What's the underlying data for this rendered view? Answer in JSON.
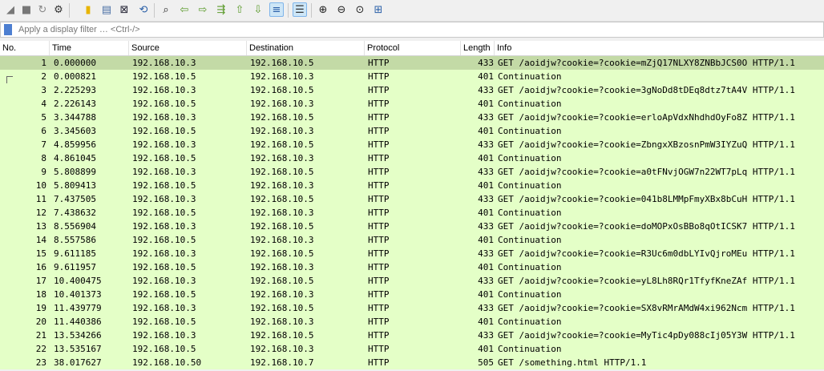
{
  "filter": {
    "placeholder": "Apply a display filter … <Ctrl-/>"
  },
  "columns": [
    "No.",
    "Time",
    "Source",
    "Destination",
    "Protocol",
    "Length",
    "Info"
  ],
  "packets": [
    {
      "no": "1",
      "time": "0.000000",
      "src": "192.168.10.3",
      "dst": "192.168.10.5",
      "proto": "HTTP",
      "len": "433",
      "info": "GET /aoidjw?cookie=?cookie=mZjQ17NLXY8ZNBbJCS0O HTTP/1.1"
    },
    {
      "no": "2",
      "time": "0.000821",
      "src": "192.168.10.5",
      "dst": "192.168.10.3",
      "proto": "HTTP",
      "len": "401",
      "info": "Continuation"
    },
    {
      "no": "3",
      "time": "2.225293",
      "src": "192.168.10.3",
      "dst": "192.168.10.5",
      "proto": "HTTP",
      "len": "433",
      "info": "GET /aoidjw?cookie=?cookie=3gNoDd8tDEq8dtz7tA4V HTTP/1.1"
    },
    {
      "no": "4",
      "time": "2.226143",
      "src": "192.168.10.5",
      "dst": "192.168.10.3",
      "proto": "HTTP",
      "len": "401",
      "info": "Continuation"
    },
    {
      "no": "5",
      "time": "3.344788",
      "src": "192.168.10.3",
      "dst": "192.168.10.5",
      "proto": "HTTP",
      "len": "433",
      "info": "GET /aoidjw?cookie=?cookie=erloApVdxNhdhdOyFo8Z HTTP/1.1"
    },
    {
      "no": "6",
      "time": "3.345603",
      "src": "192.168.10.5",
      "dst": "192.168.10.3",
      "proto": "HTTP",
      "len": "401",
      "info": "Continuation"
    },
    {
      "no": "7",
      "time": "4.859956",
      "src": "192.168.10.3",
      "dst": "192.168.10.5",
      "proto": "HTTP",
      "len": "433",
      "info": "GET /aoidjw?cookie=?cookie=ZbngxXBzosnPmW3IYZuQ HTTP/1.1"
    },
    {
      "no": "8",
      "time": "4.861045",
      "src": "192.168.10.5",
      "dst": "192.168.10.3",
      "proto": "HTTP",
      "len": "401",
      "info": "Continuation"
    },
    {
      "no": "9",
      "time": "5.808899",
      "src": "192.168.10.3",
      "dst": "192.168.10.5",
      "proto": "HTTP",
      "len": "433",
      "info": "GET /aoidjw?cookie=?cookie=a0tFNvjOGW7n22WT7pLq HTTP/1.1"
    },
    {
      "no": "10",
      "time": "5.809413",
      "src": "192.168.10.5",
      "dst": "192.168.10.3",
      "proto": "HTTP",
      "len": "401",
      "info": "Continuation"
    },
    {
      "no": "11",
      "time": "7.437505",
      "src": "192.168.10.3",
      "dst": "192.168.10.5",
      "proto": "HTTP",
      "len": "433",
      "info": "GET /aoidjw?cookie=?cookie=041b8LMMpFmyXBx8bCuH HTTP/1.1"
    },
    {
      "no": "12",
      "time": "7.438632",
      "src": "192.168.10.5",
      "dst": "192.168.10.3",
      "proto": "HTTP",
      "len": "401",
      "info": "Continuation"
    },
    {
      "no": "13",
      "time": "8.556904",
      "src": "192.168.10.3",
      "dst": "192.168.10.5",
      "proto": "HTTP",
      "len": "433",
      "info": "GET /aoidjw?cookie=?cookie=doMOPxOsBBo8qOtICSK7 HTTP/1.1"
    },
    {
      "no": "14",
      "time": "8.557586",
      "src": "192.168.10.5",
      "dst": "192.168.10.3",
      "proto": "HTTP",
      "len": "401",
      "info": "Continuation"
    },
    {
      "no": "15",
      "time": "9.611185",
      "src": "192.168.10.3",
      "dst": "192.168.10.5",
      "proto": "HTTP",
      "len": "433",
      "info": "GET /aoidjw?cookie=?cookie=R3Uc6m0dbLYIvQjroMEu HTTP/1.1"
    },
    {
      "no": "16",
      "time": "9.611957",
      "src": "192.168.10.5",
      "dst": "192.168.10.3",
      "proto": "HTTP",
      "len": "401",
      "info": "Continuation"
    },
    {
      "no": "17",
      "time": "10.400475",
      "src": "192.168.10.3",
      "dst": "192.168.10.5",
      "proto": "HTTP",
      "len": "433",
      "info": "GET /aoidjw?cookie=?cookie=yL8Lh8RQr1TfyfKneZAf HTTP/1.1"
    },
    {
      "no": "18",
      "time": "10.401373",
      "src": "192.168.10.5",
      "dst": "192.168.10.3",
      "proto": "HTTP",
      "len": "401",
      "info": "Continuation"
    },
    {
      "no": "19",
      "time": "11.439779",
      "src": "192.168.10.3",
      "dst": "192.168.10.5",
      "proto": "HTTP",
      "len": "433",
      "info": "GET /aoidjw?cookie=?cookie=SX8vRMrAMdW4xi962Ncm HTTP/1.1"
    },
    {
      "no": "20",
      "time": "11.440386",
      "src": "192.168.10.5",
      "dst": "192.168.10.3",
      "proto": "HTTP",
      "len": "401",
      "info": "Continuation"
    },
    {
      "no": "21",
      "time": "13.534266",
      "src": "192.168.10.3",
      "dst": "192.168.10.5",
      "proto": "HTTP",
      "len": "433",
      "info": "GET /aoidjw?cookie=?cookie=MyTic4pDy088cIj05Y3W HTTP/1.1"
    },
    {
      "no": "22",
      "time": "13.535167",
      "src": "192.168.10.5",
      "dst": "192.168.10.3",
      "proto": "HTTP",
      "len": "401",
      "info": "Continuation"
    },
    {
      "no": "23",
      "time": "38.017627",
      "src": "192.168.10.50",
      "dst": "192.168.10.7",
      "proto": "HTTP",
      "len": "505",
      "info": "GET /something.html HTTP/1.1"
    }
  ],
  "colors": {
    "http_row": "#e4ffc7",
    "selected_row": "#c3daa6"
  }
}
